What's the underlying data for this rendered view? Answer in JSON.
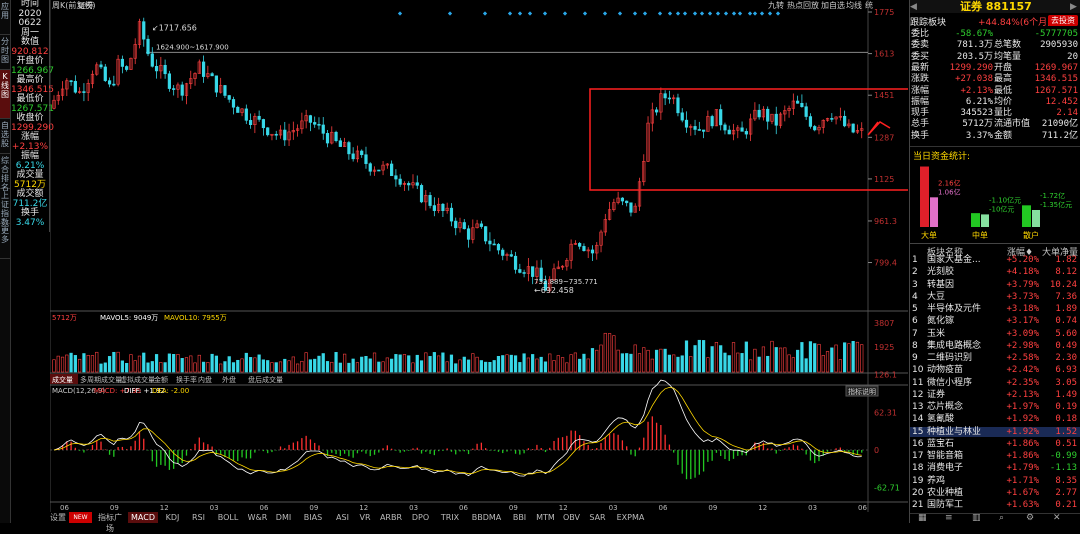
{
  "left_tabs": [
    {
      "label": "应用",
      "active": false
    },
    {
      "label": "分时图",
      "active": false
    },
    {
      "label": "K线图",
      "active": true
    },
    {
      "label": "自选股",
      "active": false
    },
    {
      "label": "综合排名",
      "active": false
    },
    {
      "label": "上证指数",
      "active": false
    },
    {
      "label": "更多",
      "active": false
    }
  ],
  "left_info": [
    {
      "label": "时间",
      "color": "white"
    },
    {
      "label": "2020",
      "color": "white"
    },
    {
      "label": "0622",
      "color": "white"
    },
    {
      "label": "周一",
      "color": "white"
    },
    {
      "label": "数值",
      "color": "white"
    },
    {
      "label": "920.812",
      "color": "red"
    },
    {
      "label": "开盘价",
      "color": "white"
    },
    {
      "label": "1266.967",
      "color": "green"
    },
    {
      "label": "最高价",
      "color": "white"
    },
    {
      "label": "1346.515",
      "color": "red"
    },
    {
      "label": "最低价",
      "color": "white"
    },
    {
      "label": "1267.571",
      "color": "green"
    },
    {
      "label": "收盘价",
      "color": "white"
    },
    {
      "label": "1299.290",
      "color": "red"
    },
    {
      "label": "涨幅",
      "color": "white"
    },
    {
      "label": "+2.13%",
      "color": "red"
    },
    {
      "label": "振幅",
      "color": "white"
    },
    {
      "label": "6.21%",
      "color": "cyan"
    },
    {
      "label": "成交量",
      "color": "white"
    },
    {
      "label": "5712万",
      "color": "yellow"
    },
    {
      "label": "成交额",
      "color": "white"
    },
    {
      "label": "711.2亿",
      "color": "cyan"
    },
    {
      "label": "换手",
      "color": "white"
    },
    {
      "label": "3.47%",
      "color": "cyan"
    }
  ],
  "header": {
    "period": "周K(前复权)",
    "name": "证券",
    "toolbar": [
      "九转",
      "热点回放",
      "加自选",
      "均线",
      "统"
    ]
  },
  "price_axis": [
    "1775",
    "1613",
    "1451",
    "1287",
    "1125",
    "961.3",
    "799.4"
  ],
  "annotations": {
    "high": "1717.656",
    "high_range": "1624.900~1617.900",
    "low": "692.458",
    "low_range": "732.889~735.771"
  },
  "volume_header": {
    "vol": "5712万",
    "ma5": "MAVOL5: 9049万",
    "ma10": "MAVOL10: 7955万"
  },
  "volume_axis": [
    "3807",
    "1925"
  ],
  "sub_tabs": [
    "成交量",
    "多周期成交量",
    "虚拟成交量",
    "金额",
    "换手率",
    "内盘",
    "外盘",
    "盘后成交量"
  ],
  "macd_header": {
    "label": "MACD(12,26,9)",
    "macd": "MACD: +7.95",
    "diff": "DIFF: +1.92",
    "dea": "DEA: -2.00",
    "tool": "指标说明"
  },
  "macd_axis": [
    "126.1",
    "62.31",
    "0",
    "-62.71"
  ],
  "time_axis": [
    "06",
    "09",
    "12",
    "03",
    "06",
    "09",
    "12",
    "03",
    "06",
    "09",
    "12",
    "03",
    "06",
    "09",
    "12",
    "03",
    "06"
  ],
  "bottom_tabs": [
    "设置",
    "NEW",
    "指标广场",
    "MACD",
    "KDJ",
    "RSI",
    "BOLL",
    "W&R",
    "DMI",
    "BIAS",
    "ASI",
    "VR",
    "ARBR",
    "DPO",
    "TRIX",
    "BBDMA",
    "BBI",
    "MTM",
    "OBV",
    "SAR",
    "EXPMA"
  ],
  "quote": {
    "title": "证券 881157",
    "follow_label": "跟踪板块",
    "follow_value": "+44.84%(6个月)",
    "trade_btn": "去投资",
    "rows": [
      {
        "l": "委比",
        "v": "-58.67%",
        "l2": "",
        "v2": "-5777705",
        "c": "green",
        "c2": "green"
      },
      {
        "l": "委卖",
        "v": "781.3万",
        "l2": "总笔数",
        "v2": "2905930",
        "c": "white",
        "c2": "white"
      },
      {
        "l": "委买",
        "v": "203.5万",
        "l2": "均笔量",
        "v2": "20",
        "c": "white",
        "c2": "white"
      },
      {
        "l": "最新",
        "v": "1299.290",
        "l2": "开盘",
        "v2": "1269.967",
        "c": "red",
        "c2": "red"
      },
      {
        "l": "涨跌",
        "v": "+27.038",
        "l2": "最高",
        "v2": "1346.515",
        "c": "red",
        "c2": "red"
      },
      {
        "l": "涨幅",
        "v": "+2.13%",
        "l2": "最低",
        "v2": "1267.571",
        "c": "red",
        "c2": "red"
      },
      {
        "l": "振幅",
        "v": "6.21%",
        "l2": "均价",
        "v2": "12.452",
        "c": "white",
        "c2": "red"
      },
      {
        "l": "现手",
        "v": "345523",
        "l2": "量比",
        "v2": "2.14",
        "c": "white",
        "c2": "red"
      },
      {
        "l": "总手",
        "v": "5712万",
        "l2": "流通市值",
        "v2": "21090亿",
        "c": "white",
        "c2": "white"
      },
      {
        "l": "换手",
        "v": "3.37%",
        "l2": "金额",
        "v2": "711.2亿",
        "c": "white",
        "c2": "white"
      }
    ]
  },
  "fund_flow": {
    "title": "当日资金统计:",
    "bars": [
      {
        "label": "大单",
        "in": "2.16亿",
        "out": "1.06亿",
        "in_value": 2.16,
        "out_value": 1.06
      },
      {
        "label": "中单",
        "in": "-1.10亿元",
        "out": "-10亿元",
        "in_value": -1.1,
        "out_value": -1.0
      },
      {
        "label": "散户",
        "in": "-1.72亿",
        "out": "-1.35亿元",
        "in_value": -1.72,
        "out_value": -1.35
      }
    ]
  },
  "board_list": {
    "headers": [
      "板块名称",
      "涨幅♦",
      "大单净量"
    ],
    "rows": [
      {
        "n": "1",
        "name": "国家大基金...",
        "pct": "+5.20%",
        "net": "1.82"
      },
      {
        "n": "2",
        "name": "光刻胶",
        "pct": "+4.18%",
        "net": "8.12"
      },
      {
        "n": "3",
        "name": "转基因",
        "pct": "+3.79%",
        "net": "10.24"
      },
      {
        "n": "4",
        "name": "大豆",
        "pct": "+3.73%",
        "net": "7.36"
      },
      {
        "n": "5",
        "name": "半导体及元件",
        "pct": "+3.18%",
        "net": "1.89"
      },
      {
        "n": "6",
        "name": "氮化镓",
        "pct": "+3.17%",
        "net": "0.74"
      },
      {
        "n": "7",
        "name": "玉米",
        "pct": "+3.09%",
        "net": "5.60"
      },
      {
        "n": "8",
        "name": "集成电路概念",
        "pct": "+2.98%",
        "net": "0.49"
      },
      {
        "n": "9",
        "name": "二维码识别",
        "pct": "+2.58%",
        "net": "2.30"
      },
      {
        "n": "10",
        "name": "动物疫苗",
        "pct": "+2.42%",
        "net": "6.93"
      },
      {
        "n": "11",
        "name": "微信小程序",
        "pct": "+2.35%",
        "net": "3.05"
      },
      {
        "n": "12",
        "name": "证券",
        "pct": "+2.13%",
        "net": "1.49"
      },
      {
        "n": "13",
        "name": "芯片概念",
        "pct": "+1.97%",
        "net": "0.19"
      },
      {
        "n": "14",
        "name": "氢氰酸",
        "pct": "+1.92%",
        "net": "0.18"
      },
      {
        "n": "15",
        "name": "种植业与林业",
        "pct": "+1.92%",
        "net": "1.52"
      },
      {
        "n": "16",
        "name": "蓝宝石",
        "pct": "+1.86%",
        "net": "0.51"
      },
      {
        "n": "17",
        "name": "智能音箱",
        "pct": "+1.86%",
        "net": "-0.99"
      },
      {
        "n": "18",
        "name": "消费电子",
        "pct": "+1.79%",
        "net": "-1.13"
      },
      {
        "n": "19",
        "name": "养鸡",
        "pct": "+1.71%",
        "net": "8.35"
      },
      {
        "n": "20",
        "name": "农业种植",
        "pct": "+1.67%",
        "net": "2.77"
      },
      {
        "n": "21",
        "name": "国防军工",
        "pct": "+1.63%",
        "net": "0.21"
      }
    ]
  },
  "bottom_icons": [
    "grid-icon",
    "list-icon",
    "chart-icon",
    "search-icon",
    "settings-icon",
    "close-icon"
  ],
  "colors": {
    "up": "#ff4040",
    "down": "#38d8e8",
    "ma1": "#ffffff",
    "ma2": "#ffd800",
    "highlight_box": "#ff2020"
  }
}
